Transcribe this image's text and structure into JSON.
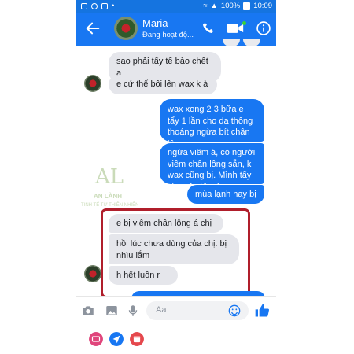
{
  "status_bar": {
    "battery": "100%",
    "time": "10:09"
  },
  "header": {
    "name": "Maria",
    "status": "Đang hoạt độ..."
  },
  "messages": [
    {
      "side": "in",
      "text": "sao phải tẩy tế bào chết ạ"
    },
    {
      "side": "in",
      "text": "e cứ thế bôi lên wax k à"
    },
    {
      "side": "out",
      "text": "wax xong 2 3 bữa e tẩy 1 lần cho da thông thoáng ngừa bít chân lông"
    },
    {
      "side": "out",
      "text": "ngừa viêm á, có người viêm chân lông sẵn, k wax cũng bị. Mình tẩy cho yên tâm hơn"
    },
    {
      "side": "out",
      "text": "mùa lạnh hay bị"
    },
    {
      "side": "in",
      "text": "e bị viêm chân lông á chị"
    },
    {
      "side": "in",
      "text": "hồi lúc chưa dùng của chị. bị nhìu lắm"
    },
    {
      "side": "in",
      "text": "h hết luôn r"
    }
  ],
  "watermark": {
    "logo": "AL",
    "name": "AN LÀNH",
    "sub": "TINH TẾ TỪ THIÊN NHIÊN"
  },
  "input": {
    "placeholder": "Aa"
  },
  "colors": {
    "brand": "#1877f2",
    "status_bar": "#1574e0",
    "incoming_bubble": "#e5e6eb",
    "highlight": "#b01e2b"
  },
  "icons": {
    "header": [
      "back-arrow-icon",
      "phone-icon",
      "video-camera-icon",
      "info-icon"
    ],
    "input_bar": [
      "camera-icon",
      "image-icon",
      "microphone-icon",
      "emoji-icon",
      "thumbs-up-icon"
    ],
    "extras": [
      "gif-icon",
      "location-icon",
      "calendar-icon"
    ]
  }
}
